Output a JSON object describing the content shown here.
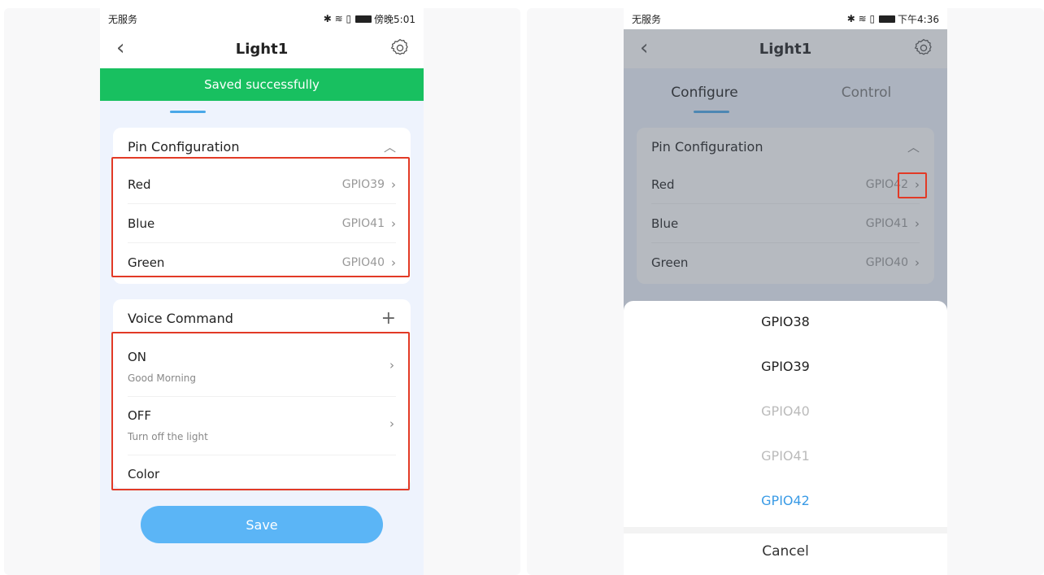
{
  "left_phone": {
    "status": {
      "carrier": "无服务",
      "icons": "✱ ≋ ▯",
      "time": "傍晚5:01"
    },
    "nav": {
      "back": "‹",
      "title": "Light1"
    },
    "toast": "Saved successfully",
    "pin_config": {
      "header": "Pin Configuration",
      "toggle": "︿",
      "rows": [
        {
          "label": "Red",
          "value": "GPIO39"
        },
        {
          "label": "Blue",
          "value": "GPIO41"
        },
        {
          "label": "Green",
          "value": "GPIO40"
        }
      ]
    },
    "voice": {
      "header": "Voice Command",
      "add": "+",
      "items": [
        {
          "title": "ON",
          "subtitle": "Good Morning"
        },
        {
          "title": "OFF",
          "subtitle": "Turn off the light"
        },
        {
          "title": "Color",
          "subtitle": ""
        }
      ]
    },
    "save_label": "Save"
  },
  "right_phone": {
    "status": {
      "carrier": "无服务",
      "icons": "✱ ≋ ▯",
      "time": "下午4:36"
    },
    "nav": {
      "back": "‹",
      "title": "Light1"
    },
    "tabs": [
      {
        "label": "Configure"
      },
      {
        "label": "Control"
      }
    ],
    "pin_config": {
      "header": "Pin Configuration",
      "toggle": "︿",
      "rows": [
        {
          "label": "Red",
          "value": "GPIO42"
        },
        {
          "label": "Blue",
          "value": "GPIO41"
        },
        {
          "label": "Green",
          "value": "GPIO40"
        }
      ]
    },
    "picker": {
      "options": [
        {
          "label": "GPIO38",
          "state": "normal"
        },
        {
          "label": "GPIO39",
          "state": "normal"
        },
        {
          "label": "GPIO40",
          "state": "disabled"
        },
        {
          "label": "GPIO41",
          "state": "disabled"
        },
        {
          "label": "GPIO42",
          "state": "selected"
        }
      ],
      "cancel": "Cancel"
    }
  },
  "colors": {
    "toast_green": "#18c060",
    "highlight_red": "#e23a26",
    "accent_blue": "#3a9be6",
    "save_blue": "#5bb5f6"
  },
  "icons": {
    "back": "chevron-left-icon",
    "settings": "gear-icon",
    "collapse": "chevron-up-icon",
    "add": "plus-icon",
    "row": "chevron-right-icon"
  }
}
